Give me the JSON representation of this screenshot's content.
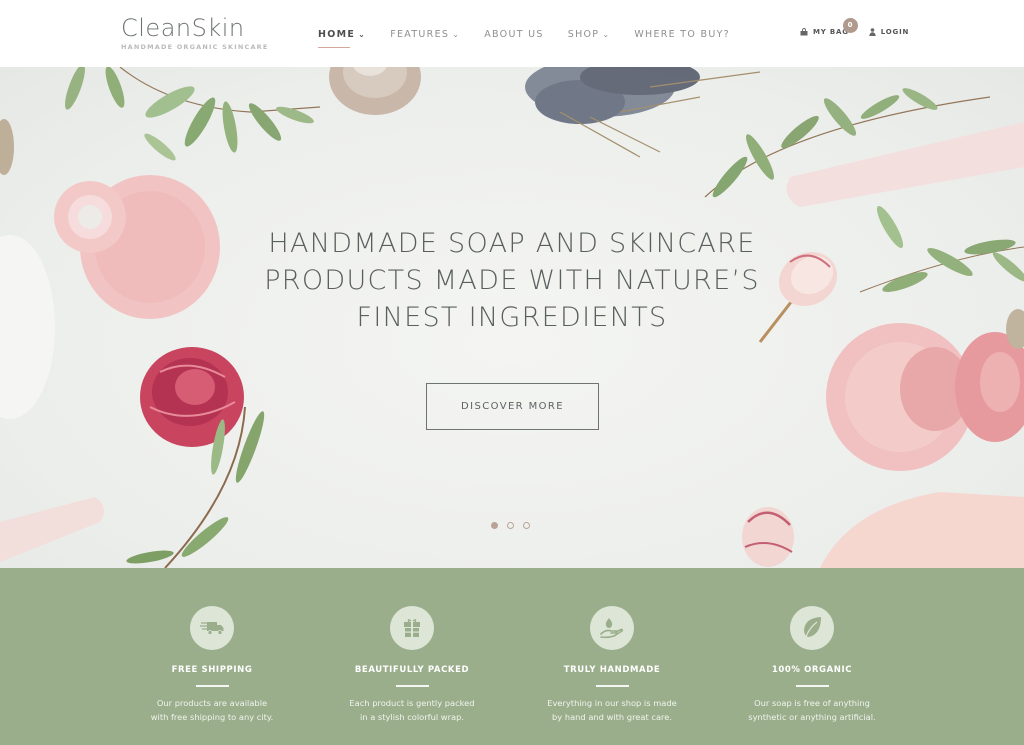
{
  "header": {
    "logo_name": "CleanSkin",
    "logo_tagline": "HANDMADE ORGANIC SKINCARE",
    "nav": [
      {
        "label": "HOME",
        "has_dropdown": true,
        "active": true
      },
      {
        "label": "FEATURES",
        "has_dropdown": true,
        "active": false
      },
      {
        "label": "ABOUT US",
        "has_dropdown": false,
        "active": false
      },
      {
        "label": "SHOP",
        "has_dropdown": true,
        "active": false
      },
      {
        "label": "WHERE TO BUY?",
        "has_dropdown": false,
        "active": false
      }
    ],
    "chevron_glyph": "⌄",
    "bag_label": "MY BAG",
    "bag_count": "0",
    "login_label": "LOGIN",
    "icons": {
      "bag": "shopping-bag-icon",
      "login": "user-icon"
    }
  },
  "hero": {
    "title_lines": [
      "HANDMADE SOAP AND SKINCARE",
      "PRODUCTS MADE WITH NATURE’S",
      "FINEST INGREDIENTS"
    ],
    "button_label": "DISCOVER MORE",
    "slides_total": 3,
    "active_slide": 1
  },
  "features": [
    {
      "icon": "delivery-truck-icon",
      "title": "FREE SHIPPING",
      "text_lines": [
        "Our products are available",
        "with free shipping to any city."
      ]
    },
    {
      "icon": "gift-box-icon",
      "title": "BEAUTIFULLY PACKED",
      "text_lines": [
        "Each product is gently packed",
        "in a stylish colorful wrap."
      ]
    },
    {
      "icon": "hand-drop-icon",
      "title": "TRULY HANDMADE",
      "text_lines": [
        "Everything in our shop is made",
        "by hand and with great care."
      ]
    },
    {
      "icon": "leaf-icon",
      "title": "100% ORGANIC",
      "text_lines": [
        "Our soap is free of anything",
        "synthetic or anything artificial."
      ]
    }
  ],
  "colors": {
    "feature_band": "#9aae8b",
    "accent": "#b09a8d",
    "text_dark": "#595e5e"
  }
}
